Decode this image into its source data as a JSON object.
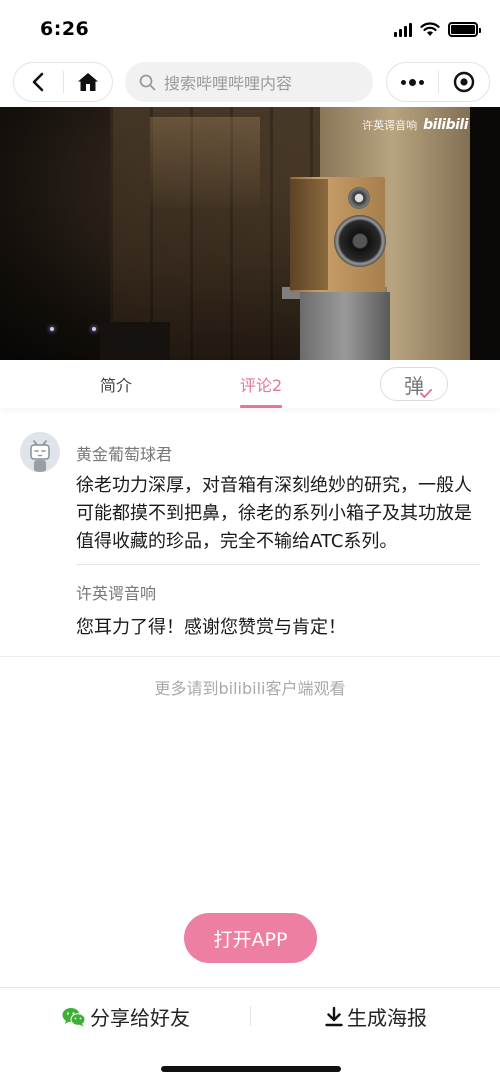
{
  "status_bar": {
    "time": "6:26"
  },
  "nav": {
    "search_placeholder": "搜索哔哩哔哩内容"
  },
  "video": {
    "watermark_text": "许英谔音响",
    "watermark_logo": "bilibili"
  },
  "tabs": {
    "intro": "简介",
    "comments": "评论2",
    "danmaku": "弹"
  },
  "comment": {
    "user": "黄金葡萄球君",
    "text": "徐老功力深厚，对音箱有深刻绝妙的研究，一般人可能都摸不到把鼻，徐老的系列小箱子及其功放是值得收藏的珍品，完全不输给ATC系列。",
    "reply_user": "许英谔音响",
    "reply_text": "您耳力了得！感谢您赞赏与肯定！"
  },
  "more_text": "更多请到bilibili客户端观看",
  "open_app_label": "打开APP",
  "bottom_bar": {
    "share_label": "分享给好友",
    "poster_label": "生成海报"
  },
  "colors": {
    "accent": "#e8739c",
    "button": "#ec7fa2",
    "wechat": "#3cb034"
  }
}
